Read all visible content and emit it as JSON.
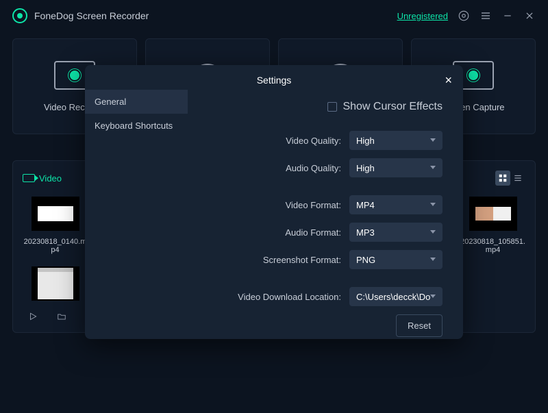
{
  "app": {
    "title": "FoneDog Screen Recorder",
    "unregistered": "Unregistered"
  },
  "modes": {
    "video": "Video Recorder",
    "capture": "Screen Capture"
  },
  "library": {
    "tab": "Video",
    "items": [
      {
        "name": "20230818_0140.mp4"
      },
      {
        "name": "20230818_105851.mp4"
      }
    ]
  },
  "settings": {
    "title": "Settings",
    "tabs": {
      "general": "General",
      "shortcuts": "Keyboard Shortcuts"
    },
    "cursor_label": "Show Cursor Effects",
    "rows": {
      "video_quality": {
        "label": "Video Quality:",
        "value": "High"
      },
      "audio_quality": {
        "label": "Audio Quality:",
        "value": "High"
      },
      "video_format": {
        "label": "Video Format:",
        "value": "MP4"
      },
      "audio_format": {
        "label": "Audio Format:",
        "value": "MP3"
      },
      "screenshot_format": {
        "label": "Screenshot Format:",
        "value": "PNG"
      },
      "download_loc": {
        "label": "Video Download Location:",
        "value": "C:\\Users\\decck\\Do"
      }
    },
    "reset": "Reset"
  }
}
